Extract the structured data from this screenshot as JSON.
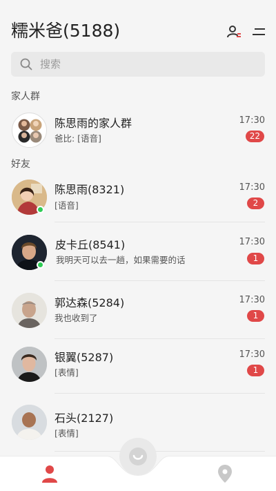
{
  "header": {
    "title": "糯米爸(5188)",
    "icons": [
      "user-settings-icon",
      "menu-icon"
    ]
  },
  "search": {
    "placeholder": "搜索",
    "icon": "search-icon"
  },
  "sections": {
    "family": "家人群",
    "friends": "好友"
  },
  "family_group": {
    "name": "陈思雨的家人群",
    "message": "爸比: [语音]",
    "time": "17:30",
    "unread": "22"
  },
  "friends": [
    {
      "name": "陈思雨(8321)",
      "message": "[语音]",
      "time": "17:30",
      "unread": "2",
      "online": true
    },
    {
      "name": "皮卡丘(8541)",
      "message": "我明天可以去一趟，如果需要的话",
      "time": "17:30",
      "unread": "1",
      "online": true
    },
    {
      "name": "郭达森(5284)",
      "message": "我也收到了",
      "time": "17:30",
      "unread": "1",
      "online": false
    },
    {
      "name": "银翼(5287)",
      "message": "[表情]",
      "time": "17:30",
      "unread": "1",
      "online": false
    },
    {
      "name": "石头(2127)",
      "message": "[表情]",
      "time": "",
      "unread": "",
      "online": false
    }
  ],
  "tabbar": {
    "items": [
      "contacts-icon",
      "chat-icon",
      "location-icon"
    ],
    "active_color": "#e04848",
    "inactive_color": "#c8c8c8"
  },
  "colors": {
    "badge": "#e04848",
    "online": "#2ecc55",
    "background": "#f5f5f5"
  }
}
